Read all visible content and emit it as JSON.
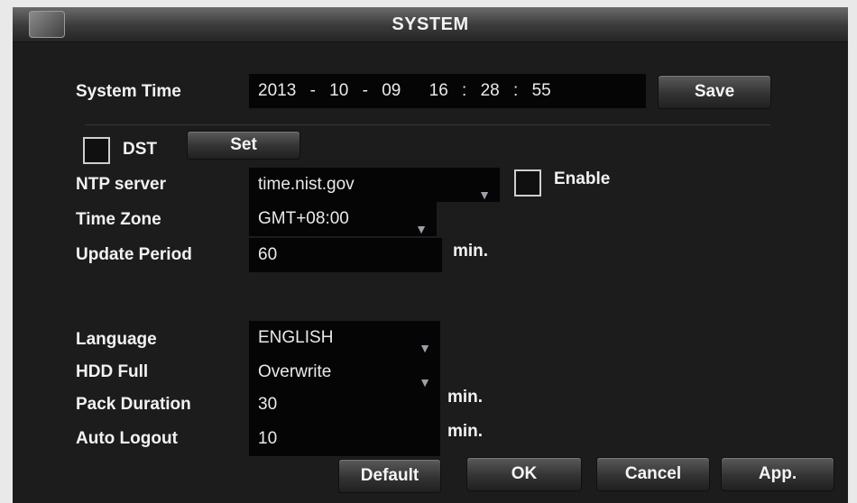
{
  "window": {
    "title": "SYSTEM",
    "logo_icon": "app-logo-icon"
  },
  "system_time": {
    "label": "System Time",
    "year": "2013",
    "month": "10",
    "day": "09",
    "hour": "16",
    "minute": "28",
    "second": "55",
    "date_sep": "-",
    "time_sep": ":",
    "save_label": "Save"
  },
  "dst": {
    "label": "DST",
    "checked": false,
    "set_label": "Set"
  },
  "ntp": {
    "label": "NTP server",
    "value": "time.nist.gov",
    "enable_label": "Enable",
    "enable_checked": false
  },
  "time_zone": {
    "label": "Time Zone",
    "value": "GMT+08:00"
  },
  "update_period": {
    "label": "Update Period",
    "value": "60",
    "unit": "min."
  },
  "language": {
    "label": "Language",
    "value": "ENGLISH"
  },
  "hdd_full": {
    "label": "HDD Full",
    "value": "Overwrite"
  },
  "pack_duration": {
    "label": "Pack Duration",
    "value": "30",
    "unit": "min."
  },
  "auto_logout": {
    "label": "Auto Logout",
    "value": "10",
    "unit": "min."
  },
  "footer": {
    "default_label": "Default",
    "ok_label": "OK",
    "cancel_label": "Cancel",
    "apply_label": "App."
  },
  "colors": {
    "background": "#1a1a1a",
    "field": "#050505",
    "text": "#f2f2f2",
    "arrow": "#9aa0a8"
  }
}
